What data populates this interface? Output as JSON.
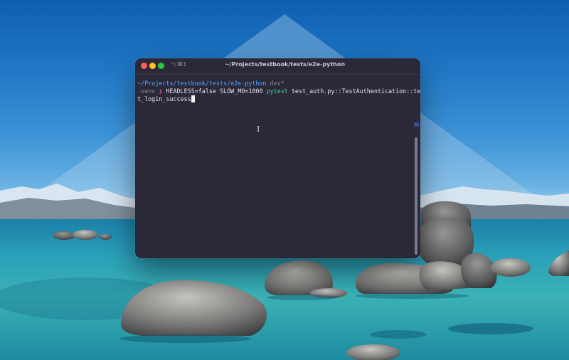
{
  "terminal": {
    "shortcut": "⌥⌘1",
    "title": "~/Projects/testbook/tests/e2e-python",
    "prompt_path": "~/Projects/testbook/tests/e2e-python",
    "branch": "dev*",
    "venv": ".venv",
    "prompt_arrow": "❯",
    "cmd_env": "HEADLESS=false SLOW_MO=1000",
    "cmd_program": "pytest",
    "cmd_args_line1": "test_auth.py::TestAuthentication::tes",
    "cmd_args_line2": "t_login_success"
  },
  "colors": {
    "terminal_bg": "#2b2838",
    "path": "#4fa8ff",
    "arrow": "#ff5f8a",
    "command": "#3ddc84",
    "close": "#fe5f57",
    "minimize": "#febc2e",
    "maximize": "#28c840"
  },
  "icons": {
    "close": "close-dot-icon",
    "minimize": "minimize-dot-icon",
    "maximize": "maximize-dot-icon",
    "text_cursor": "ibeam-cursor-icon"
  }
}
